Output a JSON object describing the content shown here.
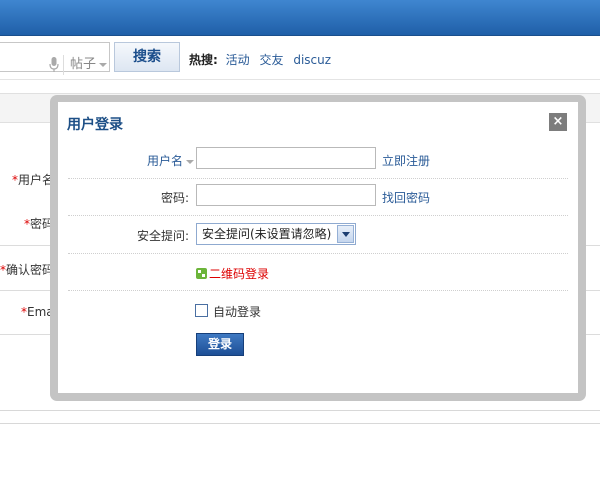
{
  "search": {
    "type_label": "帖子",
    "button_label": "搜索",
    "hot_label": "热搜:",
    "hot_links": [
      "活动",
      "交友",
      "discuz"
    ]
  },
  "background_form": {
    "fields": [
      {
        "required": "*",
        "label": "用户名:"
      },
      {
        "required": "*",
        "label": "密码:"
      },
      {
        "required": "*",
        "label": "确认密码:"
      },
      {
        "required": "*",
        "label": "Email:"
      }
    ]
  },
  "login_dialog": {
    "title": "用户登录",
    "close_label": "×",
    "username_label": "用户名",
    "username_value": "",
    "register_link": "立即注册",
    "password_label": "密码:",
    "password_value": "",
    "forgot_link": "找回密码",
    "security_label": "安全提问:",
    "security_selected": "安全提问(未设置请忽略)",
    "qr_login_link": "二维码登录",
    "auto_login_label": "自动登录",
    "auto_login_checked": false,
    "submit_label": "登录"
  },
  "colors": {
    "header_blue": "#2a6fc0",
    "link_blue": "#2a5b97",
    "title_blue": "#1d4f86",
    "required_red": "#dd0000",
    "qr_red": "#dd0000"
  },
  "icons": {
    "mic": "microphone-icon",
    "close": "close-icon",
    "qr": "qr-code-icon",
    "dropdown": "chevron-down-icon"
  }
}
